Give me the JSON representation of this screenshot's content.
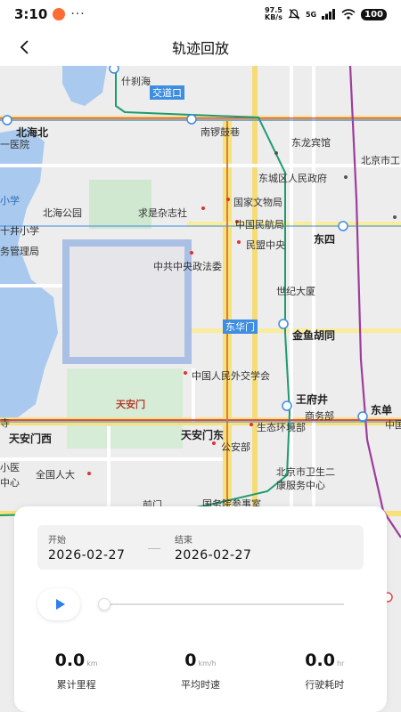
{
  "status_bar": {
    "time": "3:10",
    "dots": "···",
    "net_speed_value": "97.5",
    "net_speed_unit": "KB/s",
    "network": "5G",
    "battery": "100"
  },
  "nav": {
    "title": "轨迹回放"
  },
  "map": {
    "labels": {
      "shichahai": "什刹海",
      "jiaodaokou": "交道口",
      "nanluoguxiang": "南锣鼓巷",
      "dongsi_hotel": "东龙宾馆",
      "beihaibei": "北海北",
      "yiyiyuan": "一医院",
      "beijing_gong": "北京市工",
      "dongcheng_gov": "东城区人民政府",
      "xiao": "小学",
      "beihai_park": "北海公园",
      "qiushi": "求是杂志社",
      "wenwu": "国家文物局",
      "shijing_xiaoxue": "十井小学",
      "minhang": "中国民航局",
      "dongsi": "东四",
      "wuguanli": "务管理局",
      "minmeng": "民盟中央",
      "zhengfa": "中共中央政法委",
      "shijidasha": "世纪大厦",
      "dongqu": "东华门",
      "jinyu": "金鱼胡同",
      "waijiao": "中国人民外交学会",
      "wangfujing": "王府井",
      "tiananmen": "天安门",
      "shangwubu": "商务部",
      "dongdan": "东单",
      "zhongguo": "中国",
      "si": "寺",
      "tiananmen_dong": "天安门东",
      "shengtai": "生态环境部",
      "tiananmen_xi": "天安门西",
      "gonganbu": "公安部",
      "xiaoyi": "小医",
      "renda": "全国人大",
      "weijian": "北京市卫生二",
      "zhongxin": "中心",
      "kangfu": "康服务中心",
      "qianmen": "前门",
      "guowuyuan": "国务院参事室"
    }
  },
  "panel": {
    "start_caption": "开始",
    "start_date": "2026-02-27",
    "end_caption": "结束",
    "end_date": "2026-02-27",
    "progress": 0,
    "stats": [
      {
        "value": "0.0",
        "unit": "km",
        "caption": "累计里程"
      },
      {
        "value": "0",
        "unit": "km/h",
        "caption": "平均时速"
      },
      {
        "value": "0.0",
        "unit": "hr",
        "caption": "行驶耗时"
      }
    ]
  },
  "colors": {
    "accent": "#2d7ef0",
    "water": "#a9c9ee",
    "park": "#cfe8cf",
    "road_major": "#f7e27a",
    "metro_green": "#1e9b6e",
    "metro_purple": "#9d3d9c",
    "rail_red": "#e04b4b"
  }
}
